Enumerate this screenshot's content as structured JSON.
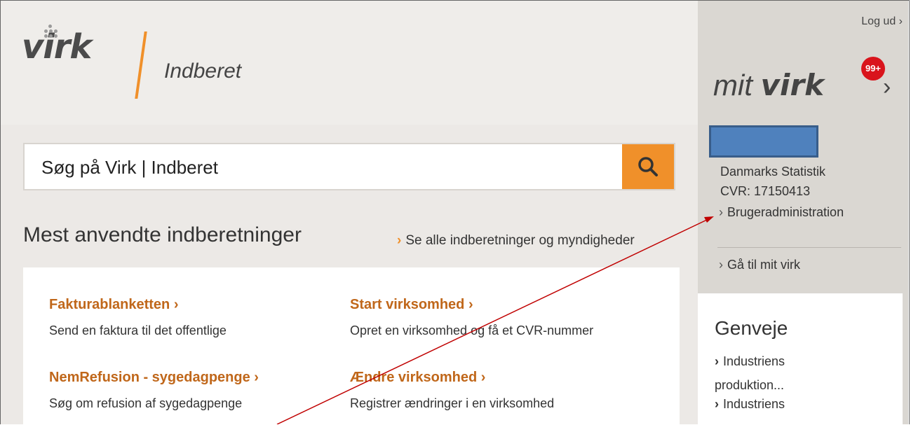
{
  "header": {
    "logo_text": "virk",
    "section_title": "Indberet"
  },
  "search": {
    "placeholder": "Søg på Virk | Indberet",
    "button_icon": "search-icon"
  },
  "main": {
    "heading": "Mest anvendte indberetninger",
    "see_all_link": "Se alle indberetninger og myndigheder",
    "items": [
      {
        "title": "Fakturablanketten",
        "description": "Send en faktura til det offentlige"
      },
      {
        "title": "Start virksomhed",
        "description": "Opret en virksomhed og få et CVR-nummer"
      },
      {
        "title": "NemRefusion - sygedagpenge",
        "description": "Søg om refusion af sygedagpenge"
      },
      {
        "title": "Ændre virksomhed",
        "description": "Registrer ændringer i en virksomhed"
      }
    ]
  },
  "sidebar": {
    "logout": "Log ud",
    "mit_prefix": "mit",
    "mit_logo": "virk",
    "badge": "99+",
    "company_name": "Danmarks Statistik",
    "cvr": "CVR: 17150413",
    "user_admin_link": "Brugeradministration",
    "goto_link": "Gå til mit virk",
    "genveje": {
      "title": "Genveje",
      "items": [
        "Industriens produktion...",
        "Industriens"
      ]
    }
  },
  "colors": {
    "accent": "#f0902a",
    "link_title": "#c0671a",
    "badge": "#d9141c",
    "redaction": "#4f81bd",
    "annotation_arrow": "#c00000"
  }
}
